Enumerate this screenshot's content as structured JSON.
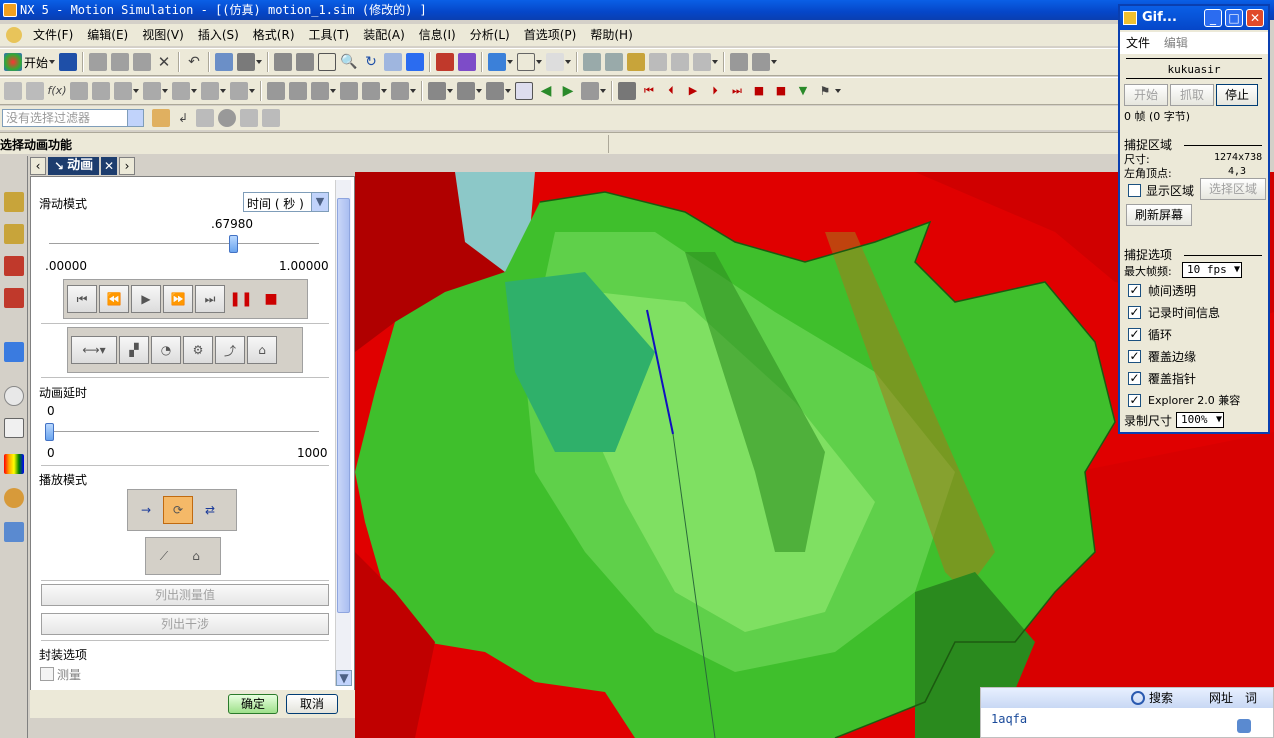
{
  "window": {
    "title": "NX 5 - Motion Simulation - [(仿真) motion_1.sim (修改的) ]"
  },
  "menu": [
    "文件(F)",
    "编辑(E)",
    "视图(V)",
    "插入(S)",
    "格式(R)",
    "工具(T)",
    "装配(A)",
    "信息(I)",
    "分析(L)",
    "首选项(P)",
    "帮助(H)"
  ],
  "toolbar": {
    "start_label": "开始"
  },
  "filter": {
    "placeholder": "没有选择过滤器"
  },
  "status": {
    "prompt": "选择动画功能"
  },
  "panel": {
    "tab_label": "动画",
    "slide_mode_label": "滑动模式",
    "time_select": "时间 ( 秒 )",
    "slider": {
      "value_text": ".67980",
      "min_text": ".00000",
      "max_text": "1.00000",
      "fraction": 0.6798
    },
    "delay_label": "动画延时",
    "delay": {
      "value_text": "0",
      "min_text": "0",
      "max_text": "1000",
      "fraction": 0
    },
    "play_mode_label": "播放模式",
    "list_measure_button": "列出测量值",
    "list_interference_button": "列出干涉",
    "package_options_label": "封装选项",
    "measure_checkbox_label": "测量",
    "ok_button": "确定",
    "cancel_button": "取消"
  },
  "gif_app": {
    "title": "Gif...",
    "menu_file": "文件",
    "menu_edit": "编辑",
    "user": "kukuasir",
    "start_button": "开始",
    "grab_button": "抓取",
    "stop_button": "停止",
    "frames_text": "0 帧 (0 字节)",
    "capture_area_heading": "捕捉区域",
    "size_label": "尺寸:",
    "size_value": "1274x738",
    "corner_label": "左角顶点:",
    "corner_value": "4,3",
    "show_area_label": "显示区域",
    "select_area_button": "选择区域",
    "refresh_button": "刷新屏幕",
    "capture_options_heading": "捕捉选项",
    "max_fps_label": "最大帧频:",
    "max_fps_value": "10 fps",
    "options": [
      {
        "label": "帧间透明",
        "checked": true
      },
      {
        "label": "记录时间信息",
        "checked": true
      },
      {
        "label": "循环",
        "checked": true
      },
      {
        "label": "覆盖边缘",
        "checked": true
      },
      {
        "label": "覆盖指针",
        "checked": true
      },
      {
        "label": "Explorer 2.0 兼容",
        "checked": true
      }
    ],
    "record_size_label": "录制尺寸",
    "record_size_value": "100%"
  },
  "ime": {
    "search_label": "搜索",
    "addr_label": "网址",
    "word_label": "词",
    "input_text": "1aqfa"
  },
  "colors": {
    "viewport_red": "#e00000",
    "gear_green": "#4ed43e",
    "accent_blue": "#0a3fb0"
  }
}
